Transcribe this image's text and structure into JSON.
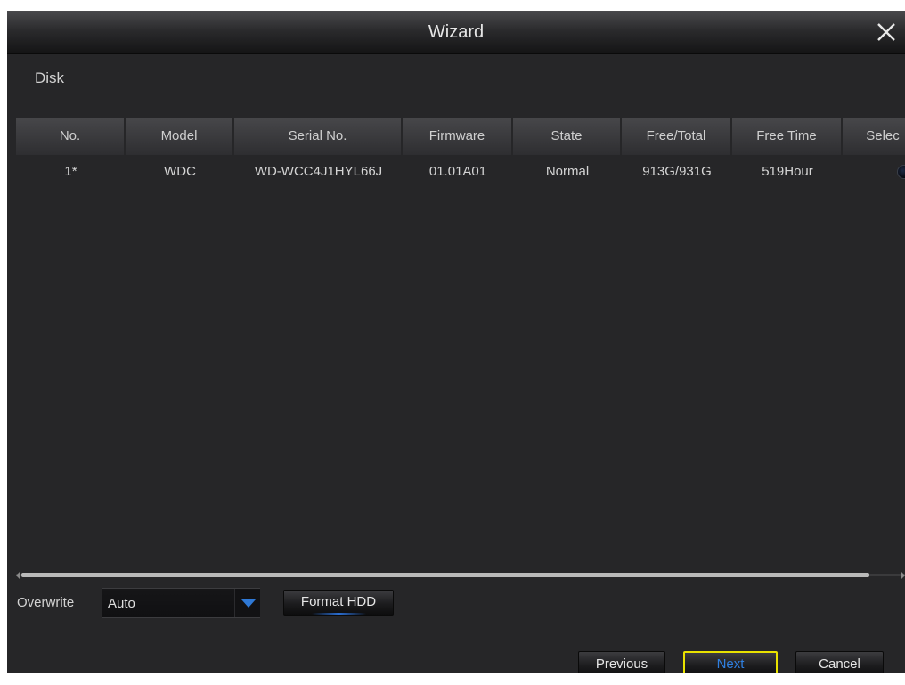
{
  "window": {
    "title": "Wizard",
    "close_icon": "close-icon"
  },
  "section": {
    "label": "Disk"
  },
  "table": {
    "columns": [
      "No.",
      "Model",
      "Serial No.",
      "Firmware",
      "State",
      "Free/Total",
      "Free Time",
      "Selec"
    ],
    "rows": [
      {
        "no": "1*",
        "model": "WDC",
        "serial": "WD-WCC4J1HYL66J",
        "firmware": "01.01A01",
        "state": "Normal",
        "free_total": "913G/931G",
        "free_time": "519Hour",
        "select_icon": "radio-button"
      }
    ]
  },
  "overwrite": {
    "label": "Overwrite",
    "value": "Auto",
    "arrow_icon": "chevron-down-icon"
  },
  "buttons": {
    "format_hdd": "Format HDD",
    "previous": "Previous",
    "next": "Next",
    "cancel": "Cancel"
  },
  "colors": {
    "background": "#262628",
    "focus_border": "#e9e200",
    "accent_blue": "#2f7fe0"
  }
}
